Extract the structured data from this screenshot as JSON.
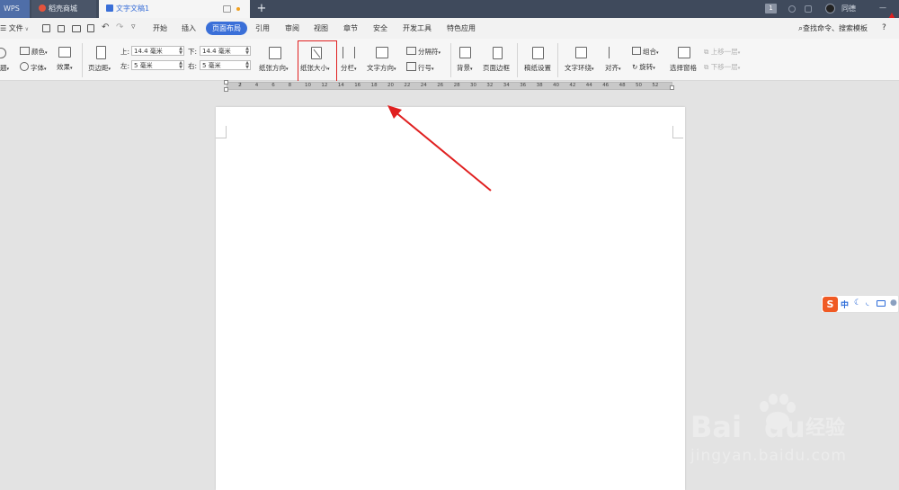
{
  "tabs": [
    {
      "label": "WPS"
    },
    {
      "label": "稻壳商城"
    },
    {
      "label": "文字文稿1"
    }
  ],
  "titlebar_right": {
    "badge": "1",
    "username": "同德",
    "minimize": "—"
  },
  "menu": [
    "开始",
    "插入",
    "页面布局",
    "引用",
    "审阅",
    "视图",
    "章节",
    "安全",
    "开发工具",
    "特色应用"
  ],
  "menu_active": "页面布局",
  "file_menu": "文件",
  "search": {
    "placeholder": "查找命令、搜索模板",
    "help": "?"
  },
  "ribbon": {
    "theme_colors": "颜色",
    "theme_fonts": "字体",
    "theme_effects": "效果",
    "theme_label": "题",
    "margins": "页边距",
    "top_label": "上:",
    "top_value": "14.4 毫米",
    "bottom_label": "下:",
    "bottom_value": "14.4 毫米",
    "left_label": "左:",
    "left_value": "5 毫米",
    "right_label": "右:",
    "right_value": "5 毫米",
    "orientation": "纸张方向",
    "paper_size": "纸张大小",
    "columns": "分栏",
    "text_direction": "文字方向",
    "breaks": "分隔符",
    "line_numbers": "行号",
    "background": "背景",
    "page_border": "页面边框",
    "manuscript": "稿纸设置",
    "text_wrap": "文字环绕",
    "align": "对齐",
    "group": "组合",
    "rotate": "旋转",
    "selection_pane": "选择窗格",
    "bring_forward": "上移一层",
    "send_backward": "下移一层"
  },
  "ruler_labels": [
    "2",
    "2",
    "4",
    "6",
    "8",
    "10",
    "12",
    "14",
    "16",
    "18",
    "20",
    "22",
    "24",
    "26",
    "28",
    "30",
    "32",
    "34",
    "36",
    "38",
    "40",
    "42",
    "44",
    "46",
    "48",
    "50",
    "52"
  ],
  "ime": {
    "chinese": "中"
  },
  "watermark": {
    "brand": "Bai",
    "brand_cn": "经验",
    "url": "jingyan.baidu.com"
  },
  "colors": {
    "accent": "#3a6fd8",
    "annotation": "#e02020",
    "titlebar": "#3f4a5c"
  }
}
